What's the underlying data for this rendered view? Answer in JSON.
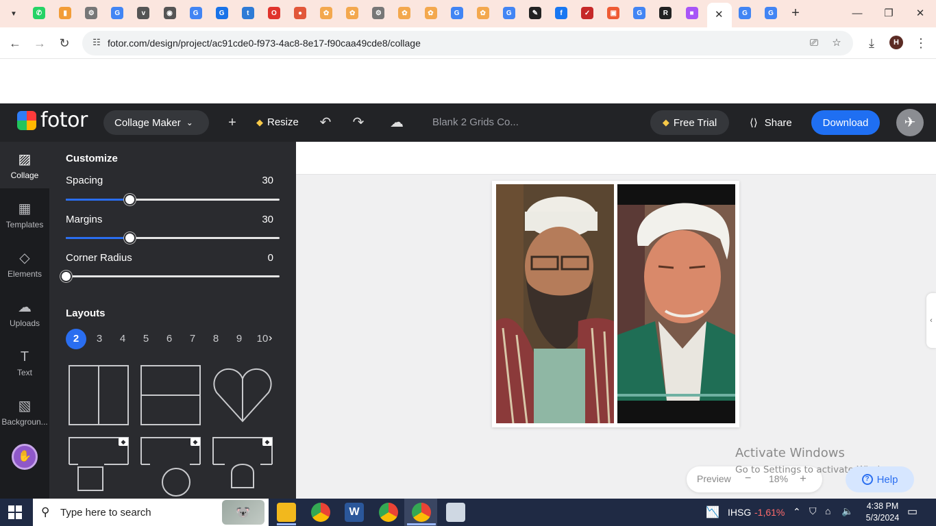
{
  "browser": {
    "url": "fotor.com/design/project/ac91cde0-f973-4ac8-8e17-f90caa49cde8/collage",
    "user_initial": "H",
    "tab_favicons": [
      {
        "icon": "whatsapp-icon",
        "color": "#25d366",
        "glyph": "✆"
      },
      {
        "icon": "analytics-icon",
        "color": "#f29d38",
        "glyph": "▮"
      },
      {
        "icon": "chrome-settings-icon",
        "color": "#777777",
        "glyph": "⚙"
      },
      {
        "icon": "google-icon",
        "color": "#4285f4",
        "glyph": "G"
      },
      {
        "icon": "vra-icon",
        "color": "#555555",
        "glyph": "v"
      },
      {
        "icon": "globe-icon",
        "color": "#555555",
        "glyph": "◉"
      },
      {
        "icon": "google-icon",
        "color": "#4285f4",
        "glyph": "G"
      },
      {
        "icon": "google-icon",
        "color": "#1a73e8",
        "glyph": "G"
      },
      {
        "icon": "ti-icon",
        "color": "#2e7bd6",
        "glyph": "t"
      },
      {
        "icon": "opera-icon",
        "color": "#e0332c",
        "glyph": "O"
      },
      {
        "icon": "chat-icon",
        "color": "#e2573a",
        "glyph": "●"
      },
      {
        "icon": "fotor-icon",
        "color": "#f3a84e",
        "glyph": "✿"
      },
      {
        "icon": "fotor-icon",
        "color": "#f3a84e",
        "glyph": "✿"
      },
      {
        "icon": "chrome-settings-icon",
        "color": "#777777",
        "glyph": "⚙"
      },
      {
        "icon": "fotor-icon",
        "color": "#f3a84e",
        "glyph": "✿"
      },
      {
        "icon": "fotor-icon",
        "color": "#f3a84e",
        "glyph": "✿"
      },
      {
        "icon": "google-icon",
        "color": "#4285f4",
        "glyph": "G"
      },
      {
        "icon": "fotor-icon",
        "color": "#f3a84e",
        "glyph": "✿"
      },
      {
        "icon": "google-icon",
        "color": "#4285f4",
        "glyph": "G"
      },
      {
        "icon": "pen-icon",
        "color": "#222222",
        "glyph": "✎"
      },
      {
        "icon": "facebook-icon",
        "color": "#1877f2",
        "glyph": "f"
      },
      {
        "icon": "acrobat-icon",
        "color": "#c62828",
        "glyph": "✓"
      },
      {
        "icon": "slides-icon",
        "color": "#ee5b34",
        "glyph": "▣"
      },
      {
        "icon": "google-icon",
        "color": "#4285f4",
        "glyph": "G"
      },
      {
        "icon": "ro-icon",
        "color": "#222222",
        "glyph": "R"
      },
      {
        "icon": "gradient-app-icon",
        "color": "#a855f7",
        "glyph": "■"
      }
    ],
    "after_active_favicons": [
      {
        "icon": "google-icon",
        "color": "#4285f4",
        "glyph": "G"
      },
      {
        "icon": "google-icon",
        "color": "#4285f4",
        "glyph": "G"
      }
    ]
  },
  "fotor": {
    "brand": "fotor",
    "mode_label": "Collage Maker",
    "resize_label": "Resize",
    "doc_name": "Blank 2 Grids Co...",
    "free_trial_label": "Free Trial",
    "share_label": "Share",
    "download_label": "Download",
    "accent_color": "#1f6ff2"
  },
  "rail": [
    {
      "label": "Collage",
      "icon": "collage-icon",
      "glyph": "▨",
      "active": true
    },
    {
      "label": "Templates",
      "icon": "templates-icon",
      "glyph": "▦",
      "active": false
    },
    {
      "label": "Elements",
      "icon": "elements-icon",
      "glyph": "◇",
      "active": false
    },
    {
      "label": "Uploads",
      "icon": "upload-cloud-icon",
      "glyph": "☁",
      "active": false
    },
    {
      "label": "Text",
      "icon": "text-icon",
      "glyph": "T",
      "active": false
    },
    {
      "label": "Backgroun...",
      "icon": "background-icon",
      "glyph": "▧",
      "active": false
    }
  ],
  "customize": {
    "title": "Customize",
    "spacing": {
      "label": "Spacing",
      "value": "30",
      "fraction": 0.3
    },
    "margins": {
      "label": "Margins",
      "value": "30",
      "fraction": 0.3
    },
    "corner_radius": {
      "label": "Corner Radius",
      "value": "0",
      "fraction": 0.0
    }
  },
  "layouts": {
    "title": "Layouts",
    "counts": [
      "2",
      "3",
      "4",
      "5",
      "6",
      "7",
      "8",
      "9",
      "10"
    ],
    "selected": "2"
  },
  "zoom": {
    "preview_label": "Preview",
    "minus": "−",
    "value": "18%",
    "plus": "+"
  },
  "help_label": "Help",
  "watermark": {
    "line1": "Activate Windows",
    "line2": "Go to Settings to activate Windows."
  },
  "taskbar": {
    "search_placeholder": "Type here to search",
    "stock_ticker": "IHSG",
    "stock_change": "-1,61%",
    "stock_color": "#ff6b6b",
    "time": "4:38 PM",
    "date": "5/3/2024"
  }
}
